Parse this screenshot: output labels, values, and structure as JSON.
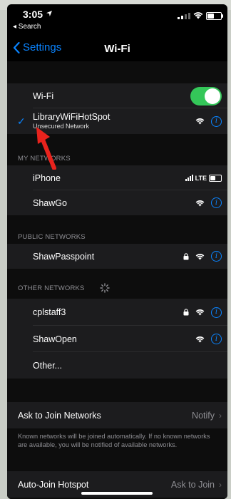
{
  "status_bar": {
    "time": "3:05",
    "back_app": "◂ Search"
  },
  "nav": {
    "back_label": "Settings",
    "title": "Wi-Fi"
  },
  "wifi_toggle": {
    "label": "Wi-Fi",
    "on": true
  },
  "connected": {
    "name": "LibraryWiFiHotSpot",
    "subtitle": "Unsecured Network"
  },
  "my_networks": {
    "title": "MY NETWORKS",
    "items": [
      {
        "name": "iPhone",
        "status": "LTE"
      },
      {
        "name": "ShawGo"
      }
    ]
  },
  "public_networks": {
    "title": "PUBLIC NETWORKS",
    "items": [
      {
        "name": "ShawPasspoint"
      }
    ]
  },
  "other_networks": {
    "title": "OTHER NETWORKS",
    "items": [
      {
        "name": "cplstaff3"
      },
      {
        "name": "ShawOpen"
      },
      {
        "name": "Other..."
      }
    ]
  },
  "ask_to_join": {
    "label": "Ask to Join Networks",
    "value": "Notify",
    "footnote": "Known networks will be joined automatically. If no known networks are available, you will be notified of available networks."
  },
  "auto_join_hotspot": {
    "label": "Auto-Join Hotspot",
    "value": "Ask to Join"
  },
  "colors": {
    "accent": "#0a84ff",
    "toggle_on": "#34c759",
    "annotation_arrow": "#e8231d"
  }
}
